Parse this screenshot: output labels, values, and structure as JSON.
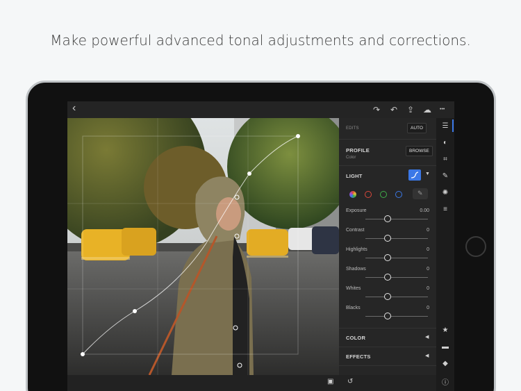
{
  "headline": "Make powerful advanced tonal adjustments and corrections.",
  "topbar": {
    "back_icon": "‹",
    "redo_icon": "↷",
    "undo_icon": "↶",
    "share_icon": "⇪",
    "cloud_icon": "☁",
    "more_icon": "•••"
  },
  "panel": {
    "edits_label": "EDITS",
    "auto_label": "AUTO",
    "profile_label": "PROFILE",
    "profile_value": "Color",
    "browse_label": "BROWSE",
    "light_label": "LIGHT",
    "color_section": "COLOR",
    "effects_section": "EFFECTS",
    "sliders": [
      {
        "label": "Exposure",
        "value": "0.00"
      },
      {
        "label": "Contrast",
        "value": "0"
      },
      {
        "label": "Highlights",
        "value": "0"
      },
      {
        "label": "Shadows",
        "value": "0"
      },
      {
        "label": "Whites",
        "value": "0"
      },
      {
        "label": "Blacks",
        "value": "0"
      }
    ],
    "channel_colors": [
      "#e8e8e8",
      "#d9483b",
      "#3fae49",
      "#3b78e7"
    ],
    "accent": "#3b78e7"
  },
  "rail": {
    "icons": [
      "sliders-icon",
      "color-icon",
      "crop-icon",
      "brush-icon",
      "detail-icon",
      "presets-icon",
      "star-icon",
      "comment-icon",
      "tag-icon",
      "info-icon"
    ]
  }
}
